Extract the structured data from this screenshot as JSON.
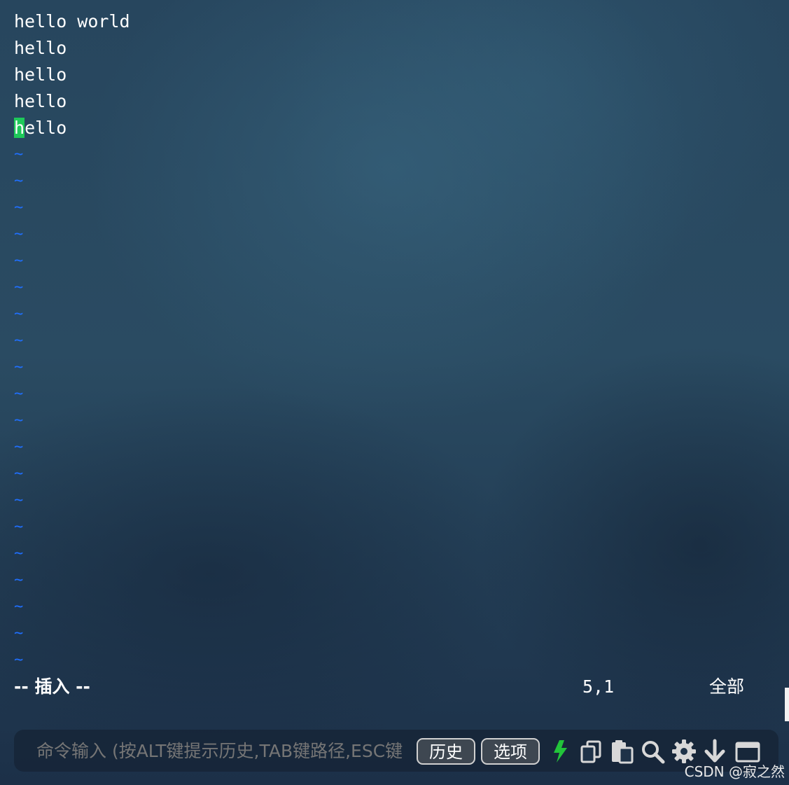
{
  "editor": {
    "lines": [
      {
        "cursor_char": "",
        "rest": "hello world"
      },
      {
        "cursor_char": "",
        "rest": "hello"
      },
      {
        "cursor_char": "",
        "rest": "hello"
      },
      {
        "cursor_char": "",
        "rest": "hello"
      },
      {
        "cursor_char": "h",
        "rest": "ello"
      }
    ],
    "empty_line_marker": "~",
    "cursor_color": "#1ec95a",
    "tilde_color": "#1f6fff"
  },
  "status": {
    "mode": "-- 插入 --",
    "position": "5,1",
    "scope": "全部"
  },
  "command_bar": {
    "placeholder": "命令输入 (按ALT键提示历史,TAB键路径,ESC键",
    "history_button": "历史",
    "options_button": "选项",
    "icons": [
      "lightning-icon",
      "copy-icon",
      "paste-icon",
      "search-icon",
      "gear-icon",
      "download-icon",
      "window-icon"
    ],
    "lightning_color": "#22c43a"
  },
  "watermark": "CSDN @寂之然"
}
